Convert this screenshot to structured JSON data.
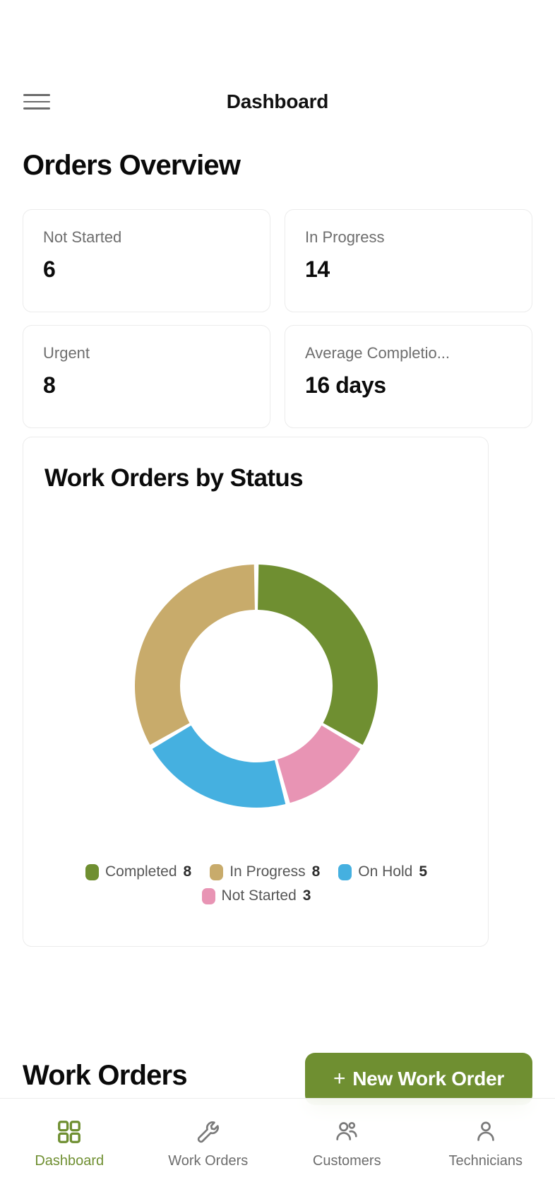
{
  "topbar": {
    "menu_icon": "hamburger-menu-icon",
    "title": "Dashboard"
  },
  "page": {
    "title": "Orders Overview"
  },
  "stats": [
    {
      "label": "Not Started",
      "value": "6"
    },
    {
      "label": "In Progress",
      "value": "14"
    },
    {
      "label": "Urgent",
      "value": "8"
    },
    {
      "label": "Average Completio...",
      "value": "16 days"
    }
  ],
  "chart_card": {
    "title": "Work Orders by Status"
  },
  "chart_data": {
    "type": "pie",
    "variant": "donut",
    "title": "Work Orders by Status",
    "categories": [
      "Completed",
      "In Progress",
      "On Hold",
      "Not Started"
    ],
    "values": [
      8,
      8,
      5,
      3
    ],
    "total": 24,
    "colors": [
      "#6f8f31",
      "#c8ab6b",
      "#45b0e0",
      "#e894b4"
    ],
    "draw_order_clockwise_from_top": [
      {
        "name": "Completed",
        "value": 8,
        "color": "#6f8f31",
        "start_deg": 0,
        "sweep_deg": 120
      },
      {
        "name": "Not Started",
        "value": 3,
        "color": "#e894b4",
        "start_deg": 120,
        "sweep_deg": 45
      },
      {
        "name": "On Hold",
        "value": 5,
        "color": "#45b0e0",
        "start_deg": 165,
        "sweep_deg": 75
      },
      {
        "name": "In Progress",
        "value": 8,
        "color": "#c8ab6b",
        "start_deg": 240,
        "sweep_deg": 120
      }
    ],
    "legend_position": "bottom",
    "grid": false,
    "xlabel": "",
    "ylabel": ""
  },
  "legend": {
    "row1": [
      {
        "label": "Completed",
        "value": "8",
        "color": "#6f8f31"
      },
      {
        "label": "In Progress",
        "value": "8",
        "color": "#c8ab6b"
      },
      {
        "label": "On Hold",
        "value": "5",
        "color": "#45b0e0"
      }
    ],
    "row2": [
      {
        "label": "Not Started",
        "value": "3",
        "color": "#e894b4"
      }
    ]
  },
  "work_orders": {
    "heading": "Work Orders",
    "new_button_label": "New Work Order",
    "new_button_icon": "plus-icon",
    "new_button_color": "#6f8f31"
  },
  "bottom_nav": [
    {
      "label": "Dashboard",
      "icon": "grid-icon",
      "active": true
    },
    {
      "label": "Work Orders",
      "icon": "wrench-icon",
      "active": false
    },
    {
      "label": "Customers",
      "icon": "users-icon",
      "active": false
    },
    {
      "label": "Technicians",
      "icon": "user-icon",
      "active": false
    }
  ]
}
